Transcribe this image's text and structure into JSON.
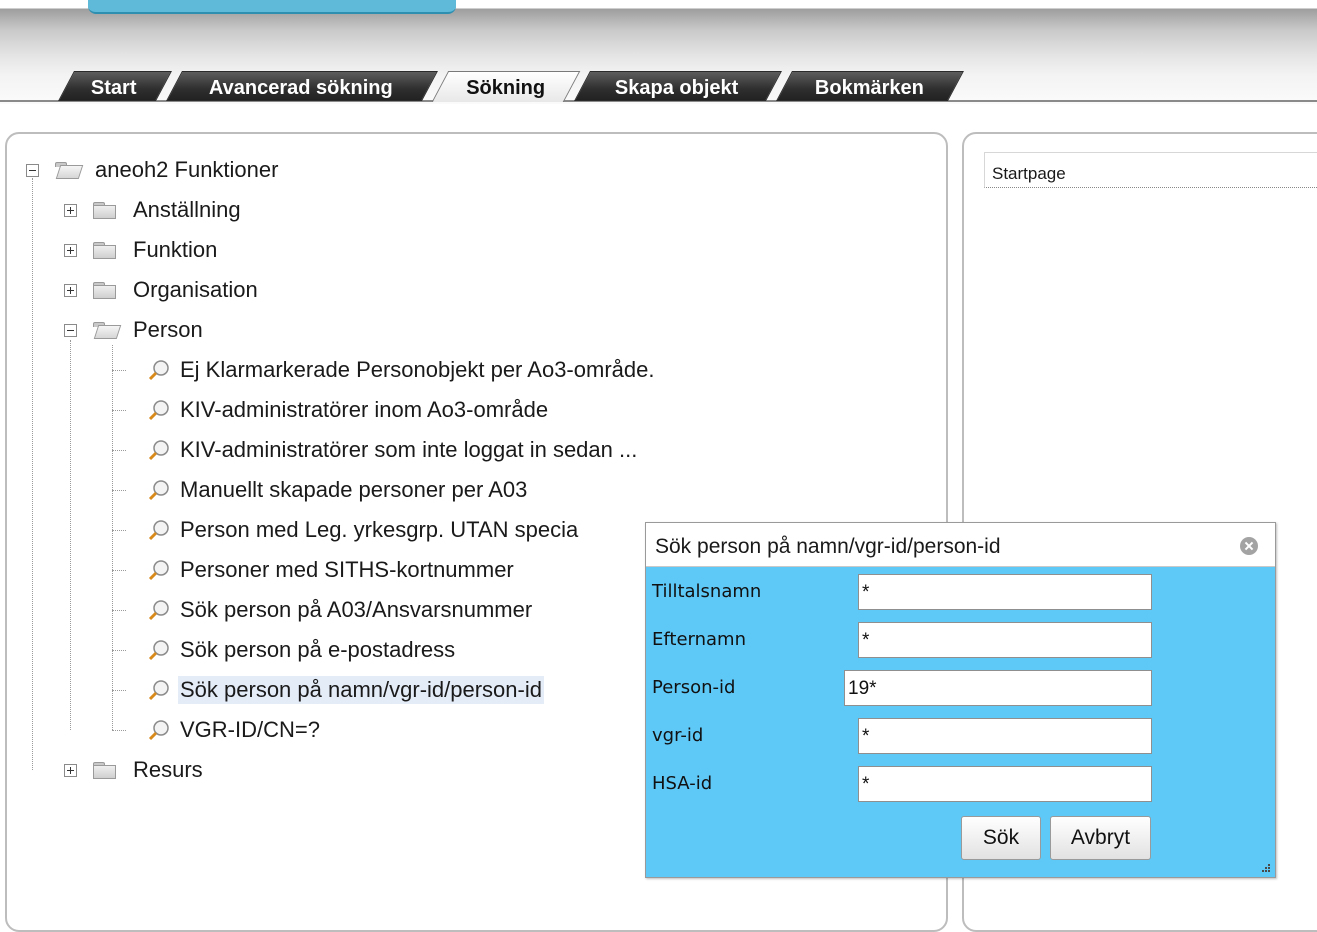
{
  "tabs": [
    {
      "label": "Start",
      "active": false
    },
    {
      "label": "Avancerad sökning",
      "active": false
    },
    {
      "label": "Sökning",
      "active": true
    },
    {
      "label": "Skapa objekt",
      "active": false
    },
    {
      "label": "Bokmärken",
      "active": false
    }
  ],
  "tree": {
    "root": {
      "label": "aneoh2 Funktioner",
      "expanded": true
    },
    "folders": [
      {
        "label": "Anställning",
        "expanded": false
      },
      {
        "label": "Funktion",
        "expanded": false
      },
      {
        "label": "Organisation",
        "expanded": false
      },
      {
        "label": "Person",
        "expanded": true
      },
      {
        "label": "Resurs",
        "expanded": false
      }
    ],
    "person_queries": [
      "Ej Klarmarkerade Personobjekt per Ao3-område.",
      "KIV-administratörer inom Ao3-område",
      "KIV-administratörer som inte loggat in sedan ...",
      "Manuellt skapade personer per A03",
      "Person med Leg. yrkesgrp. UTAN specia",
      "Personer med SITHS-kortnummer",
      "Sök person på A03/Ansvarsnummer",
      "Sök person på e-postadress",
      "Sök person på namn/vgr-id/person-id",
      "VGR-ID/CN=?"
    ],
    "selected_query": "Sök person på namn/vgr-id/person-id"
  },
  "right_panel": {
    "header": "Startpage"
  },
  "dialog": {
    "title": "Sök person på namn/vgr-id/person-id",
    "fields": [
      {
        "label": "Tilltalsnamn",
        "value": "*"
      },
      {
        "label": "Efternamn",
        "value": "*"
      },
      {
        "label": "Person-id",
        "value": "19*"
      },
      {
        "label": "vgr-id",
        "value": "*"
      },
      {
        "label": "HSA-id",
        "value": "*"
      }
    ],
    "search_button": "Sök",
    "cancel_button": "Avbryt"
  },
  "colors": {
    "dialog_bg": "#5ec8f7",
    "selected_row": "#e4ecf8",
    "tab_dark": "#2f2f2f",
    "header_accent": "#5fb9d8"
  },
  "icons": {
    "tree_toggle": "expand-collapse-icon",
    "folder": "folder-icon",
    "query": "magnifier-query-icon",
    "close": "close-circle-icon",
    "grip": "resize-grip-icon"
  }
}
